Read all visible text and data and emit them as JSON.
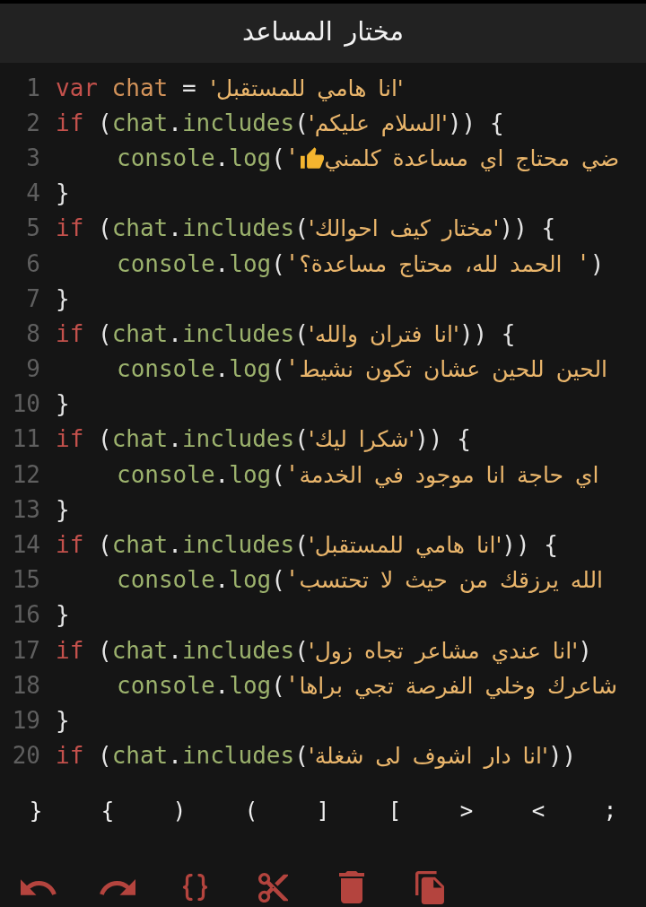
{
  "title": "مختار المساعد",
  "code_lines": [
    {
      "number": "1",
      "kind": "declaration",
      "keyword": "var",
      "name": " chat",
      "operator": " = ",
      "string": {
        "text": "'انا هامي للمستقبل'"
      }
    },
    {
      "number": "2",
      "kind": "condition",
      "keyword": "if",
      "open": " (",
      "object": "chat",
      "dot": ".",
      "method": "includes",
      "call": "(",
      "string": {
        "text": "'السلام عليكم'"
      },
      "end": ")) {",
      "children": [
        {
          "number": "3",
          "kind": "call",
          "object": "console",
          "dot": ".",
          "method": "log",
          "call": "(",
          "string": {
            "open": "'",
            "emoji": true,
            "text": "ضي محتاج اي مساعدة كلمني"
          }
        }
      ]
    },
    {
      "number": "4",
      "kind": "block_end",
      "brace": "}"
    },
    {
      "number": "5",
      "kind": "condition",
      "keyword": "if",
      "open": " (",
      "object": "chat",
      "dot": ".",
      "method": "includes",
      "call": "(",
      "string": {
        "text": "'مختار كيف احوالك'"
      },
      "end": ")) {",
      "children": [
        {
          "number": "6",
          "kind": "call",
          "object": "console",
          "dot": ".",
          "method": "log",
          "call": "(",
          "string": {
            "open": "'",
            "text": "الحمد لله، محتاج مساعدة؟",
            "close": " '"
          },
          "end": ")"
        }
      ]
    },
    {
      "number": "7",
      "kind": "block_end",
      "brace": "}"
    },
    {
      "number": "8",
      "kind": "condition",
      "keyword": "if",
      "open": " (",
      "object": "chat",
      "dot": ".",
      "method": "includes",
      "call": "(",
      "string": {
        "text": "'انا فتران والله'"
      },
      "end": ")) {",
      "children": [
        {
          "number": "9",
          "kind": "call",
          "object": "console",
          "dot": ".",
          "method": "log",
          "call": "(",
          "string": {
            "open": "'",
            "text": "الحين للحين عشان تكون نشيط"
          }
        }
      ]
    },
    {
      "number": "10",
      "kind": "block_end",
      "brace": "}"
    },
    {
      "number": "11",
      "kind": "condition",
      "keyword": "if",
      "open": " (",
      "object": "chat",
      "dot": ".",
      "method": "includes",
      "call": "(",
      "string": {
        "text": "'شكرا ليك'"
      },
      "end": ")) {",
      "children": [
        {
          "number": "12",
          "kind": "call",
          "object": "console",
          "dot": ".",
          "method": "log",
          "call": "(",
          "string": {
            "open": "'",
            "text": "اي حاجة انا موجود في الخدمة"
          }
        }
      ]
    },
    {
      "number": "13",
      "kind": "block_end",
      "brace": "}"
    },
    {
      "number": "14",
      "kind": "condition",
      "keyword": "if",
      "open": " (",
      "object": "chat",
      "dot": ".",
      "method": "includes",
      "call": "(",
      "string": {
        "text": "'انا هامي للمستقبل'"
      },
      "end": ")) {",
      "children": [
        {
          "number": "15",
          "kind": "call",
          "object": "console",
          "dot": ".",
          "method": "log",
          "call": "(",
          "string": {
            "open": "'",
            "text": "الله يرزقك من حيث لا تحتسب"
          }
        }
      ]
    },
    {
      "number": "16",
      "kind": "block_end",
      "brace": "}"
    },
    {
      "number": "17",
      "kind": "condition",
      "keyword": "if",
      "open": " (",
      "object": "chat",
      "dot": ".",
      "method": "includes",
      "call": "(",
      "string": {
        "text": "'انا عندي مشاعر تجاه زول'"
      },
      "end": ")",
      "children": [
        {
          "number": "18",
          "kind": "call",
          "object": "console",
          "dot": ".",
          "method": "log",
          "call": "(",
          "string": {
            "open": "'",
            "text": "شاعرك وخلي الفرصة تجي براها"
          }
        }
      ]
    },
    {
      "number": "19",
      "kind": "block_end",
      "brace": "}"
    },
    {
      "number": "20",
      "kind": "condition",
      "keyword": "if",
      "open": " (",
      "object": "chat",
      "dot": ".",
      "method": "includes",
      "call": "(",
      "string": {
        "text": "'انا دار اشوف لى شغلة'"
      },
      "end": "))"
    }
  ],
  "symbol_keys": [
    ";",
    ">",
    "<",
    "]",
    "[",
    ")",
    "(",
    "}",
    "{"
  ],
  "toolbar": [
    {
      "kind": "undo"
    },
    {
      "kind": "redo"
    },
    {
      "kind": "format"
    },
    {
      "kind": "cut"
    },
    {
      "kind": "delete"
    },
    {
      "kind": "copy"
    }
  ]
}
